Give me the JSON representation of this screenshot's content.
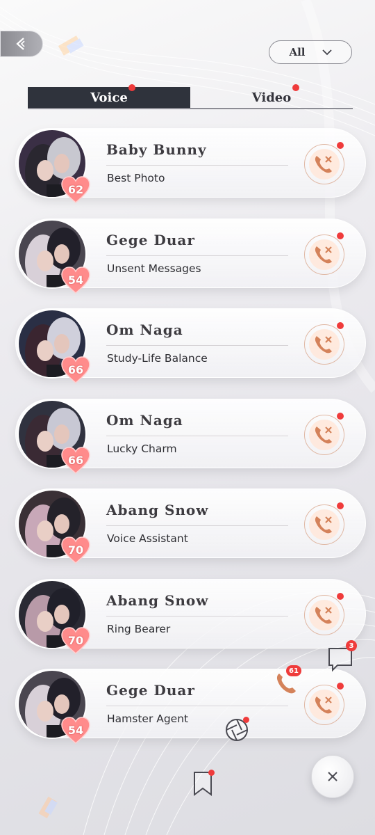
{
  "header": {
    "filter_label": "All"
  },
  "tabs": [
    {
      "label": "Voice"
    },
    {
      "label": "Video"
    }
  ],
  "calls": [
    {
      "name": "Baby Bunny",
      "topic": "Best Photo",
      "level": "62"
    },
    {
      "name": "Gege Duar",
      "topic": "Unsent Messages",
      "level": "54"
    },
    {
      "name": "Om Naga",
      "topic": "Study-Life Balance",
      "level": "66"
    },
    {
      "name": "Om Naga",
      "topic": "Lucky Charm",
      "level": "66"
    },
    {
      "name": "Abang Snow",
      "topic": "Voice Assistant",
      "level": "70"
    },
    {
      "name": "Abang Snow",
      "topic": "Ring Bearer",
      "level": "70"
    },
    {
      "name": "Gege Duar",
      "topic": "Hamster Agent",
      "level": "54"
    }
  ],
  "quick_menu": {
    "chat_badge": "3",
    "phone_badge": "61"
  },
  "colors": {
    "accent": "#ef3b3b",
    "tab_active": "#2f333c",
    "call_icon": "#d4825a"
  },
  "icons": [
    "back-icon",
    "chevron-down-icon",
    "phone-missed-icon",
    "heart-icon",
    "chat-icon",
    "phone-icon",
    "aperture-icon",
    "bookmark-icon",
    "close-icon"
  ]
}
